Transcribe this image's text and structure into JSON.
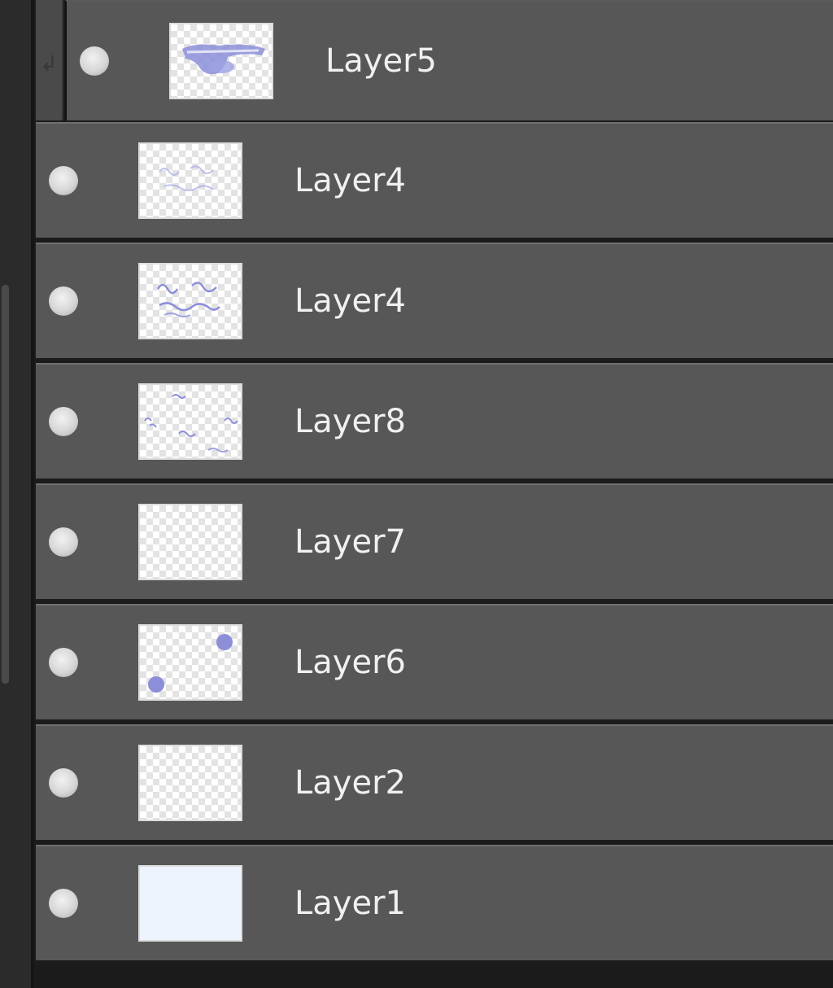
{
  "layers_panel": {
    "layers": [
      {
        "id": "l5",
        "name": "Layer5",
        "clipped": true,
        "visible": true,
        "thumb": "purple-smudge"
      },
      {
        "id": "l4a",
        "name": "Layer4",
        "clipped": false,
        "visible": true,
        "thumb": "faint-sketch"
      },
      {
        "id": "l4b",
        "name": "Layer4",
        "clipped": false,
        "visible": true,
        "thumb": "sketch"
      },
      {
        "id": "l8",
        "name": "Layer8",
        "clipped": false,
        "visible": true,
        "thumb": "scattered-marks"
      },
      {
        "id": "l7",
        "name": "Layer7",
        "clipped": false,
        "visible": true,
        "thumb": "empty"
      },
      {
        "id": "l6",
        "name": "Layer6",
        "clipped": false,
        "visible": true,
        "thumb": "two-dots"
      },
      {
        "id": "l2",
        "name": "Layer2",
        "clipped": false,
        "visible": true,
        "thumb": "empty"
      },
      {
        "id": "l1",
        "name": "Layer1",
        "clipped": false,
        "visible": true,
        "thumb": "solid-light-blue"
      }
    ]
  },
  "colors": {
    "row_background": "#575757",
    "panel_background": "#1b1b1b",
    "text": "#f0f0f0",
    "thumb_ink": "#8c8fd8",
    "layer1_fill": "#eef4fd"
  },
  "icons": {
    "visibility": "eye-dot-icon",
    "clip": "clip-arrow-icon"
  }
}
